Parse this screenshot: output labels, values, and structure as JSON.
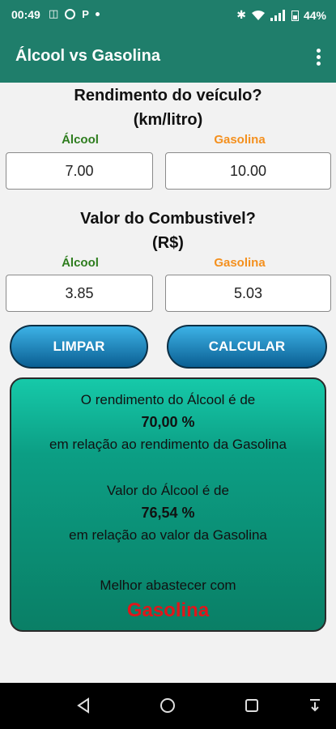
{
  "status": {
    "time": "00:49",
    "battery": "44%"
  },
  "app": {
    "title": "Álcool vs Gasolina"
  },
  "rendimento": {
    "heading_line1": "Rendimento do veículo?",
    "heading_line2": "(km/litro)",
    "alcool_label": "Álcool",
    "gasolina_label": "Gasolina",
    "alcool_value": "7.00",
    "gasolina_value": "10.00"
  },
  "valor": {
    "heading_line1": "Valor do Combustivel?",
    "heading_line2": "(R$)",
    "alcool_label": "Álcool",
    "gasolina_label": "Gasolina",
    "alcool_value": "3.85",
    "gasolina_value": "5.03"
  },
  "buttons": {
    "clear_label": "LIMPAR",
    "calc_label": "CALCULAR"
  },
  "result": {
    "rend_line1": "O rendimento do Álcool é de",
    "rend_pct": "70,00 %",
    "rend_line2": "em relação ao rendimento da Gasolina",
    "valor_line1": "Valor do Álcool é de",
    "valor_pct": "76,54 %",
    "valor_line2": "em relação ao valor da Gasolina",
    "melhor_line": "Melhor abastecer com",
    "winner": "Gasolina"
  },
  "colors": {
    "primary": "#1f7e6b",
    "alcool": "#2e7d1e",
    "gasolina": "#f4901e",
    "winner": "#e0161a"
  }
}
